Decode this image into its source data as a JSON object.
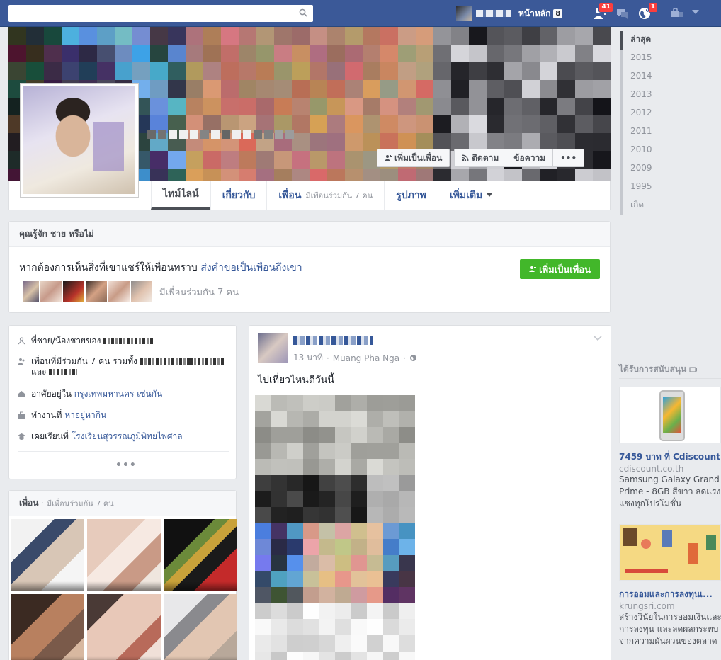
{
  "colors": {
    "brand": "#3b5998",
    "link": "#365899",
    "green": "#42b72a",
    "badge": "#fa3e3e",
    "muted": "#90949c"
  },
  "topbar": {
    "search_placeholder": "",
    "home_label": "หน้าหลัก",
    "home_count": "8",
    "friend_requests_badge": "41",
    "notifications_badge": "1",
    "icons": [
      "search-icon",
      "friend-requests-icon",
      "messages-icon",
      "globe-notifications-icon",
      "lock-icon",
      "caret-down-icon"
    ]
  },
  "cover": {
    "add_friend_label": "เพิ่มเป็นเพื่อน",
    "follow_label": "ติดตาม",
    "message_label": "ข้อความ",
    "more_label": "•••"
  },
  "tabs": [
    {
      "label": "ไทม์ไลน์",
      "active": true
    },
    {
      "label": "เกี่ยวกับ"
    },
    {
      "label": "เพื่อน",
      "sub": "มีเพื่อนร่วมกัน 7 คน"
    },
    {
      "label": "รูปภาพ"
    },
    {
      "label": "เพิ่มเติม"
    }
  ],
  "years": [
    "ล่าสุด",
    "2015",
    "2014",
    "2013",
    "2012",
    "2011",
    "2010",
    "2009",
    "1995",
    "เกิด"
  ],
  "know": {
    "header": "คุณรู้จัก ชาย หรือไม่",
    "text": "หากต้องการเห็นสิ่งที่เขาแชร์ให้เพื่อนทราบ",
    "link": "ส่งคำขอเป็นเพื่อนถึงเขา",
    "button": "เพิ่มเป็นเพื่อน",
    "mutual": "มีเพื่อนร่วมกัน 7 คน"
  },
  "intro": {
    "sibling_prefix": "พี่ชาย/น้องชายของ",
    "mutual_line1": "เพื่อนที่มีร่วมกัน 7 คน รวมทั้ง",
    "mutual_line2": "และ",
    "lives_prefix": "อาศัยอยู่ใน",
    "lives_link": "กรุงเทพมหานคร เช่นกัน",
    "work_prefix": "ทำงานที่",
    "work_link": "หาอยู่หากิน",
    "study_prefix": "เคยเรียนที่",
    "study_link": "โรงเรียนสุวรรณภูมิพิทยไพศาล",
    "more": "•••"
  },
  "friends_box": {
    "title": "เพื่อน",
    "separator": "·",
    "sub": "มีเพื่อนร่วมกัน 7 คน"
  },
  "post": {
    "time": "13 นาที",
    "place": "Muang Pha Nga",
    "separator": "·",
    "text": "ไปเที่ยวไหนดีวันนี้"
  },
  "sponsored": {
    "header": "ได้รับการสนับสนุน",
    "ads": [
      {
        "title": "7459 บาท ที่ Cdiscount",
        "domain": "cdiscount.co.th",
        "desc": "Samsung Galaxy Grand\nPrime - 8GB สีขาว ลดแรง\nแซงทุกโปรโมชั่น"
      },
      {
        "title": "การออมและการลงทุนเ...",
        "domain": "krungsri.com",
        "desc": "สร้างวินัยในการออมเงินและ\nการลงทุน และลดผลกระทบ\nจากความผันผวนของตลาด"
      }
    ]
  }
}
